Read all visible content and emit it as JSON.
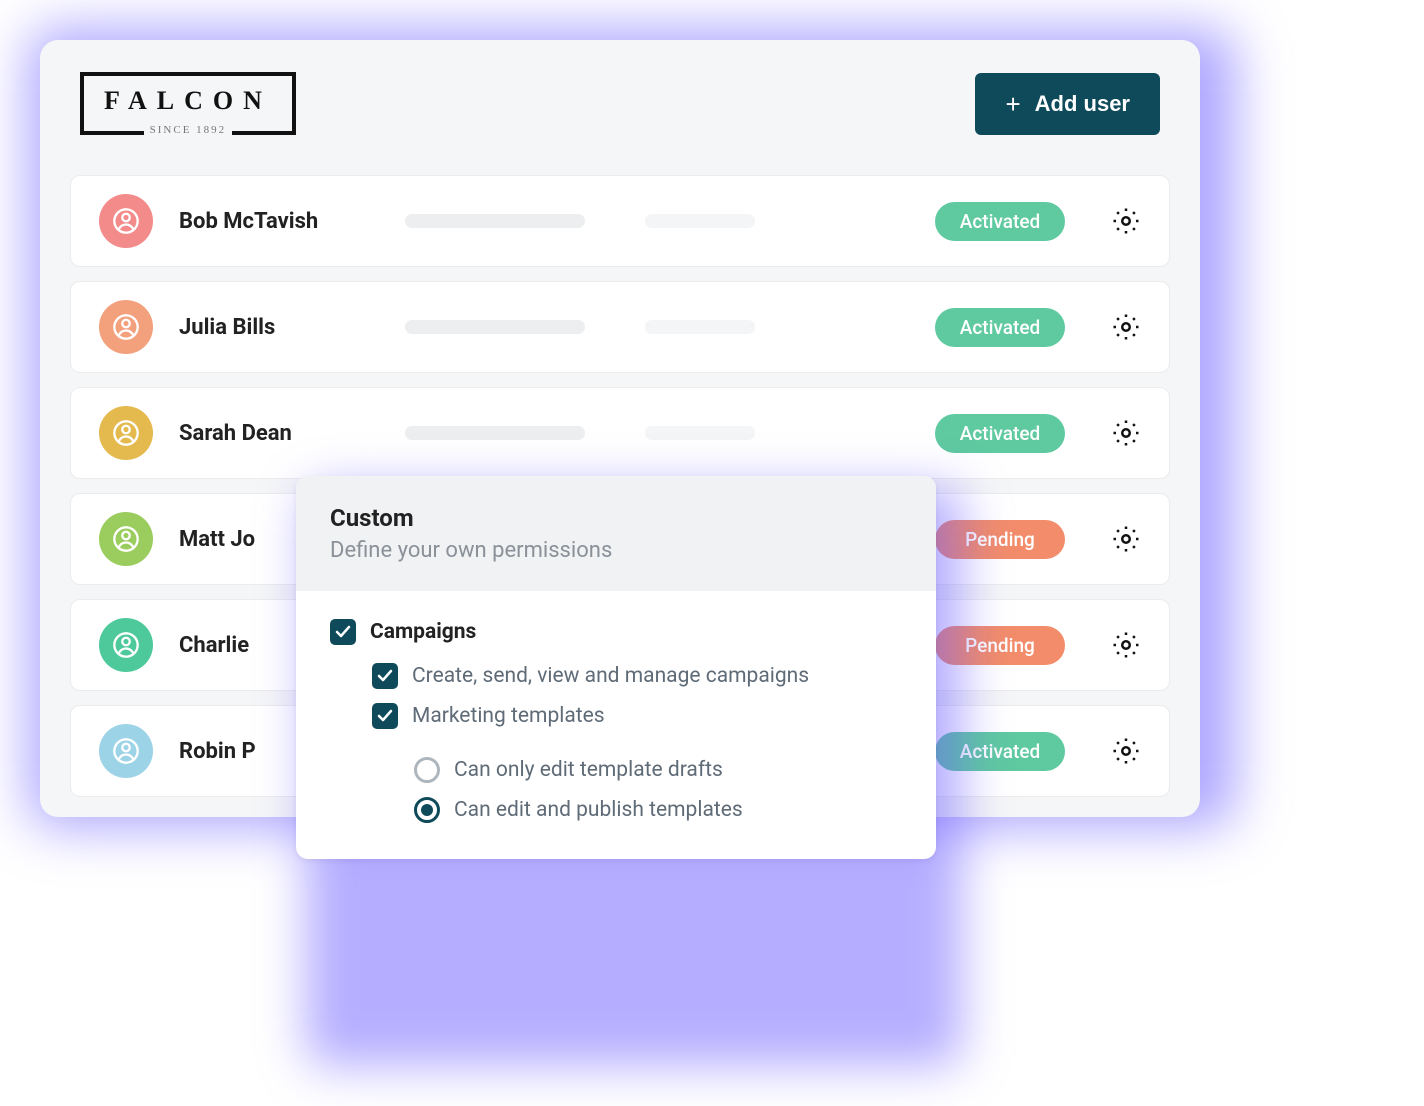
{
  "brand": {
    "name": "FALCON",
    "tagline": "SINCE 1892"
  },
  "header": {
    "add_user_label": "Add user"
  },
  "users": [
    {
      "name": "Bob McTavish",
      "status": "Activated",
      "status_class": "status-activated",
      "avatar_color": "#f38b8b"
    },
    {
      "name": "Julia Bills",
      "status": "Activated",
      "status_class": "status-activated",
      "avatar_color": "#f3a07c"
    },
    {
      "name": "Sarah Dean",
      "status": "Activated",
      "status_class": "status-activated",
      "avatar_color": "#e4b94e"
    },
    {
      "name": "Matt Jo",
      "status": "Pending",
      "status_class": "status-pending",
      "avatar_color": "#9acc5e"
    },
    {
      "name": "Charlie",
      "status": "Pending",
      "status_class": "status-pending",
      "avatar_color": "#4ec99b"
    },
    {
      "name": "Robin P",
      "status": "Activated",
      "status_class": "status-activated",
      "avatar_color": "#9cd3e6"
    }
  ],
  "popover": {
    "title": "Custom",
    "subtitle": "Define your own permissions",
    "group": "Campaigns",
    "perm1": "Create, send, view and manage campaigns",
    "perm2": "Marketing templates",
    "radio1": "Can only edit template drafts",
    "radio2": "Can edit and publish templates"
  }
}
